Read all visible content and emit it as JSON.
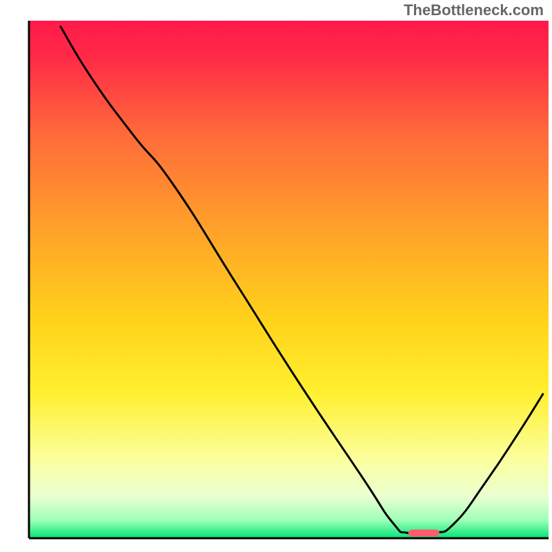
{
  "watermark": "TheBottleneck.com",
  "chart_data": {
    "type": "line",
    "title": "",
    "xlabel": "",
    "ylabel": "",
    "xlim": [
      0,
      100
    ],
    "ylim": [
      0,
      100
    ],
    "gradient_stops": [
      {
        "offset": 0.0,
        "color": "#ff1a4b"
      },
      {
        "offset": 0.07,
        "color": "#ff2a47"
      },
      {
        "offset": 0.22,
        "color": "#ff6a3a"
      },
      {
        "offset": 0.4,
        "color": "#ffa12a"
      },
      {
        "offset": 0.58,
        "color": "#ffd31a"
      },
      {
        "offset": 0.72,
        "color": "#fff030"
      },
      {
        "offset": 0.85,
        "color": "#fbffa0"
      },
      {
        "offset": 0.92,
        "color": "#e9ffd0"
      },
      {
        "offset": 0.965,
        "color": "#9fffb8"
      },
      {
        "offset": 1.0,
        "color": "#00e676"
      }
    ],
    "curve_points": [
      {
        "x": 6.0,
        "y": 99.0
      },
      {
        "x": 12.0,
        "y": 89.0
      },
      {
        "x": 20.0,
        "y": 78.0
      },
      {
        "x": 28.0,
        "y": 68.0
      },
      {
        "x": 40.0,
        "y": 49.0
      },
      {
        "x": 52.0,
        "y": 30.0
      },
      {
        "x": 64.0,
        "y": 12.0
      },
      {
        "x": 70.0,
        "y": 3.0
      },
      {
        "x": 73.0,
        "y": 1.0
      },
      {
        "x": 78.0,
        "y": 1.0
      },
      {
        "x": 82.0,
        "y": 3.0
      },
      {
        "x": 88.0,
        "y": 11.0
      },
      {
        "x": 94.0,
        "y": 20.0
      },
      {
        "x": 99.0,
        "y": 28.0
      }
    ],
    "marker": {
      "x_start": 73.0,
      "x_end": 79.0,
      "y": 1.0,
      "color": "#ff5a6e"
    },
    "axis_color": "#000000",
    "curve_color": "#000000"
  }
}
